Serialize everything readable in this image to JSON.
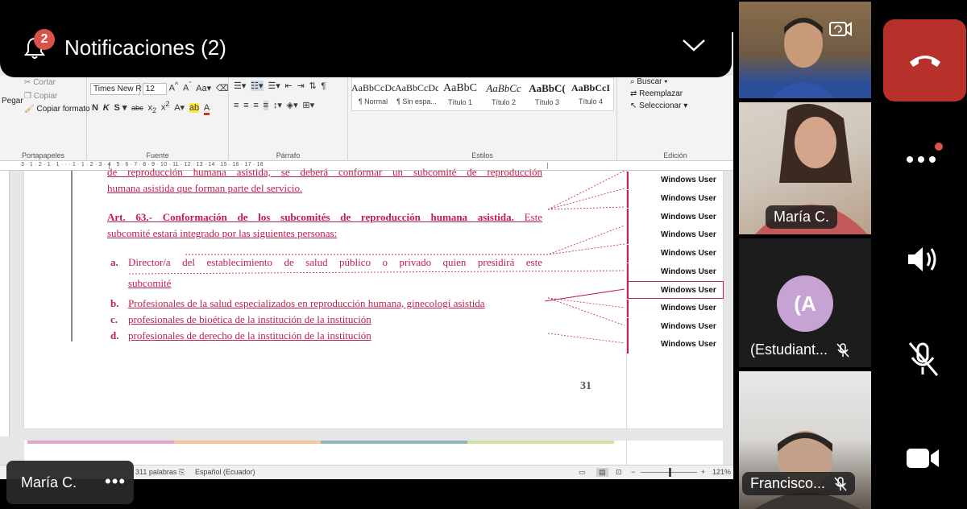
{
  "notification": {
    "count": "2",
    "title": "Notificaciones (2)"
  },
  "ribbon": {
    "clipboard": {
      "cut": "Cortar",
      "copy": "Copiar",
      "paste": "Pegar",
      "format_painter": "Copiar formato",
      "caption": "Portapapeles"
    },
    "font": {
      "name": "Times New R",
      "size": "12",
      "caption": "Fuente"
    },
    "paragraph": {
      "caption": "Párrafo"
    },
    "styles": {
      "caption": "Estilos",
      "items": [
        {
          "preview": "AaBbCcDc",
          "name": "¶ Normal"
        },
        {
          "preview": "AaBbCcDc",
          "name": "¶ Sin espa..."
        },
        {
          "preview": "AaBbC",
          "name": "Título 1"
        },
        {
          "preview": "AaBbCc",
          "name": "Título 2"
        },
        {
          "preview": "AaBbC(",
          "name": "Título 3"
        },
        {
          "preview": "AaBbCcI",
          "name": "Título 4"
        }
      ]
    },
    "editing": {
      "find": "Buscar",
      "replace": "Reemplazar",
      "select": "Seleccionar",
      "caption": "Edición"
    }
  },
  "document": {
    "line_top_1": "de reproducción humana asistida, se deberá conformar un subcomité de reproducción",
    "line_top_2": "humana asistida que forman parte del servicio.",
    "art_heading": "Art. 63.- Conformación de los subcomités de reproducción humana asistida.",
    "art_rest_1": " Este",
    "art_line_2": "subcomité estará integrado por las siguientes personas:",
    "items": [
      {
        "marker": "a.",
        "text": "Director/a del establecimiento de salud público o privado quien presidirá este",
        "text2": "subcomité"
      },
      {
        "marker": "b.",
        "text": "Profesionales de la salud especializados en reproducción humana, ginecologí asistida"
      },
      {
        "marker": "c.",
        "text": "profesionales de bioética de la institución de la institución"
      },
      {
        "marker": "d.",
        "text": "profesionales de derecho de la institución de la institución"
      }
    ],
    "page_number": "31"
  },
  "comments": [
    "Windows User",
    "Windows User",
    "Windows User",
    "Windows User",
    "Windows User",
    "Windows User",
    "Windows User",
    "Windows User",
    "Windows User",
    "Windows User"
  ],
  "statusbar": {
    "words": "311 palabras",
    "language": "Español (Ecuador)",
    "zoom": "121%"
  },
  "participants": {
    "maria": "María C.",
    "student_avatar": "(A",
    "student": "(Estudiant...",
    "francisco": "Francisco..."
  },
  "self_label": {
    "name": "María C.",
    "more": "•••"
  },
  "colors": {
    "hangup": "#b8302a",
    "badge": "#d9534a",
    "track_changes": "#c0204a"
  }
}
